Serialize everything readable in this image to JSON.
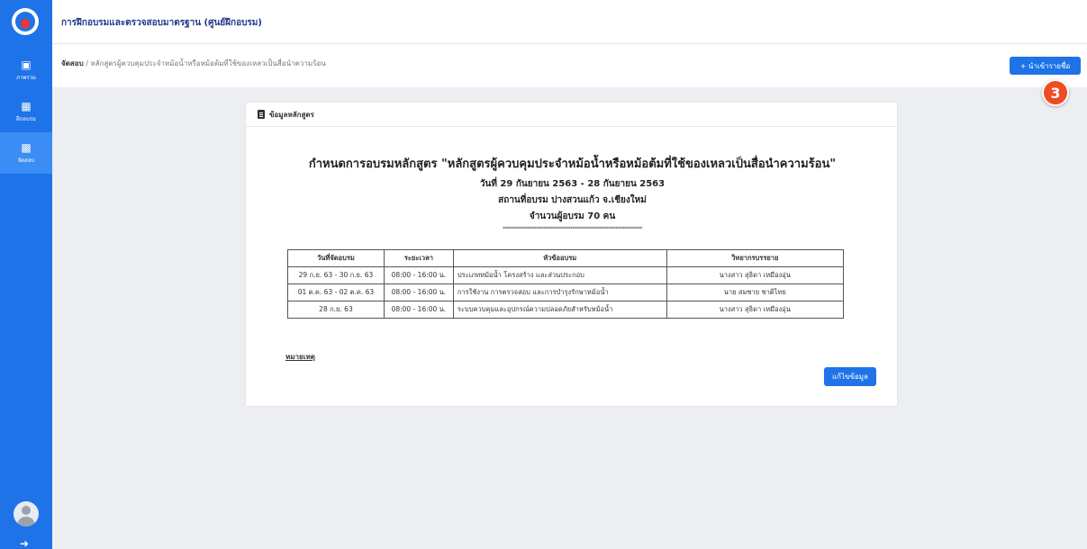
{
  "sidebar": {
    "logo_icon": "app-logo-icon",
    "items": [
      {
        "label": "ภาพรวม",
        "icon": "monitor-icon",
        "active": false
      },
      {
        "label": "ฝึกอบรม",
        "icon": "grid-icon",
        "active": false
      },
      {
        "label": "จัดสอบ",
        "icon": "building-icon",
        "active": true
      }
    ],
    "avatar_icon": "user-avatar-icon",
    "logout_icon": "logout-icon"
  },
  "header": {
    "title": "การฝึกอบรมและตรวจสอบมาตรฐาน (ศูนย์ฝึกอบรม)"
  },
  "breadcrumb": {
    "root": "จัดสอบ",
    "separator": " / ",
    "current": "หลักสูตรผู้ควบคุมประจำหม้อน้ำหรือหม้อต้มที่ใช้ของเหลวเป็นสื่อนำความร้อน"
  },
  "actions": {
    "import_label": "+ นำเข้ารายชื่อ"
  },
  "step_badge": "3",
  "card": {
    "header_label": "ข้อมูลหลักสูตร",
    "course_title": "กำหนดการอบรมหลักสูตร \"หลักสูตรผู้ควบคุมประจำหม้อน้ำหรือหม้อต้มที่ใช้ของเหลวเป็นสื่อนำความร้อน\"",
    "date_range": "วันที่ 29 กันยายน 2563 - 28 กันยายน 2563",
    "location": "สถานที่อบรม ปางสวนแก้ว จ.เชียงใหม่",
    "attendees": "จำนวนผู้อบรม 70 คน",
    "separator": "**************************************************************"
  },
  "schedule": {
    "columns": [
      "วันที่จัดอบรม",
      "ระยะเวลา",
      "หัวข้ออบรม",
      "วิทยากรบรรยาย"
    ],
    "rows": [
      {
        "date": "29 ก.ย. 63 - 30 ก.ย. 63",
        "time": "08:00 - 16:00 น.",
        "topic": "ประเภทหม้อน้ำ โครงสร้าง และส่วนประกอบ",
        "speaker": "นางสาว สุธิดา เหมืองอุ่น"
      },
      {
        "date": "01 ต.ค. 63 - 02 ต.ค. 63",
        "time": "08:00 - 16:00 น.",
        "topic": "การใช้งาน การตรวจสอบ และการบำรุงรักษาหม้อน้ำ",
        "speaker": "นาย สมชาย ชาติไทย"
      },
      {
        "date": "28 ก.ย. 63",
        "time": "08:00 - 16:00 น.",
        "topic": "ระบบควบคุมและอุปกรณ์ความปลอดภัยสำหรับหม้อน้ำ",
        "speaker": "นางสาว สุธิดา เหมืองอุ่น"
      }
    ]
  },
  "remark_label": "หมายเหตุ",
  "edit_label": "แก้ไขข้อมูล",
  "colors": {
    "primary": "#1e73e8",
    "badge": "#ef4b24",
    "background": "#eceef1"
  }
}
